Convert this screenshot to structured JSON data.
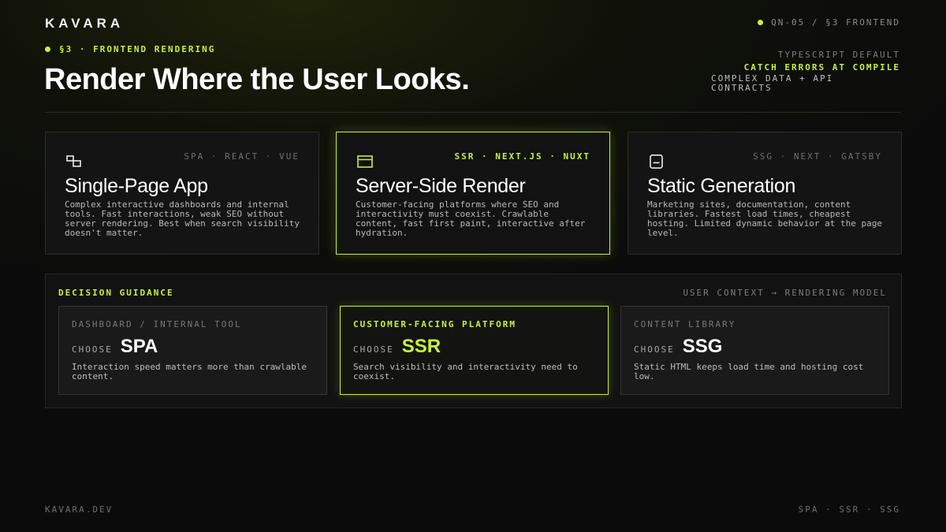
{
  "brand": "KAVARA",
  "header_tag": "QN-05 / §3 FRONTEND",
  "eyebrow": "§3 · FRONTEND RENDERING",
  "title": "Render Where the User Looks.",
  "meta": {
    "line1": "TYPESCRIPT DEFAULT",
    "line2": "CATCH ERRORS AT COMPILE",
    "line3": "COMPLEX DATA + API CONTRACTS"
  },
  "cards": [
    {
      "tags": "SPA · REACT · VUE",
      "icon": "windows-icon",
      "title": "Single-Page App",
      "desc": "Complex interactive dashboards and internal tools. Fast interactions, weak SEO without server rendering. Best when search visibility doesn't matter."
    },
    {
      "tags": "SSR · NEXT.JS · NUXT",
      "icon": "browser-window-icon",
      "title": "Server-Side Render",
      "desc": "Customer-facing platforms where SEO and interactivity must coexist. Crawlable content, fast first paint, interactive after hydration."
    },
    {
      "tags": "SSG · NEXT · GATSBY",
      "icon": "document-icon",
      "title": "Static Generation",
      "desc": "Marketing sites, documentation, content libraries. Fastest load times, cheapest hosting. Limited dynamic behavior at the page level."
    }
  ],
  "guidance": {
    "label": "DECISION GUIDANCE",
    "right": "USER CONTEXT → RENDERING MODEL",
    "choices": [
      {
        "context": "DASHBOARD / INTERNAL TOOL",
        "choose_label": "CHOOSE",
        "model": "SPA",
        "desc": "Interaction speed matters more than crawlable content."
      },
      {
        "context": "CUSTOMER-FACING PLATFORM",
        "choose_label": "CHOOSE",
        "model": "SSR",
        "desc": "Search visibility and interactivity need to coexist."
      },
      {
        "context": "CONTENT LIBRARY",
        "choose_label": "CHOOSE",
        "model": "SSG",
        "desc": "Static HTML keeps load time and hosting cost low."
      }
    ]
  },
  "footer": {
    "left": "KAVARA.DEV",
    "right": "SPA · SSR · SSG"
  },
  "colors": {
    "accent": "#c8f03c",
    "background": "#0b0b0b"
  }
}
